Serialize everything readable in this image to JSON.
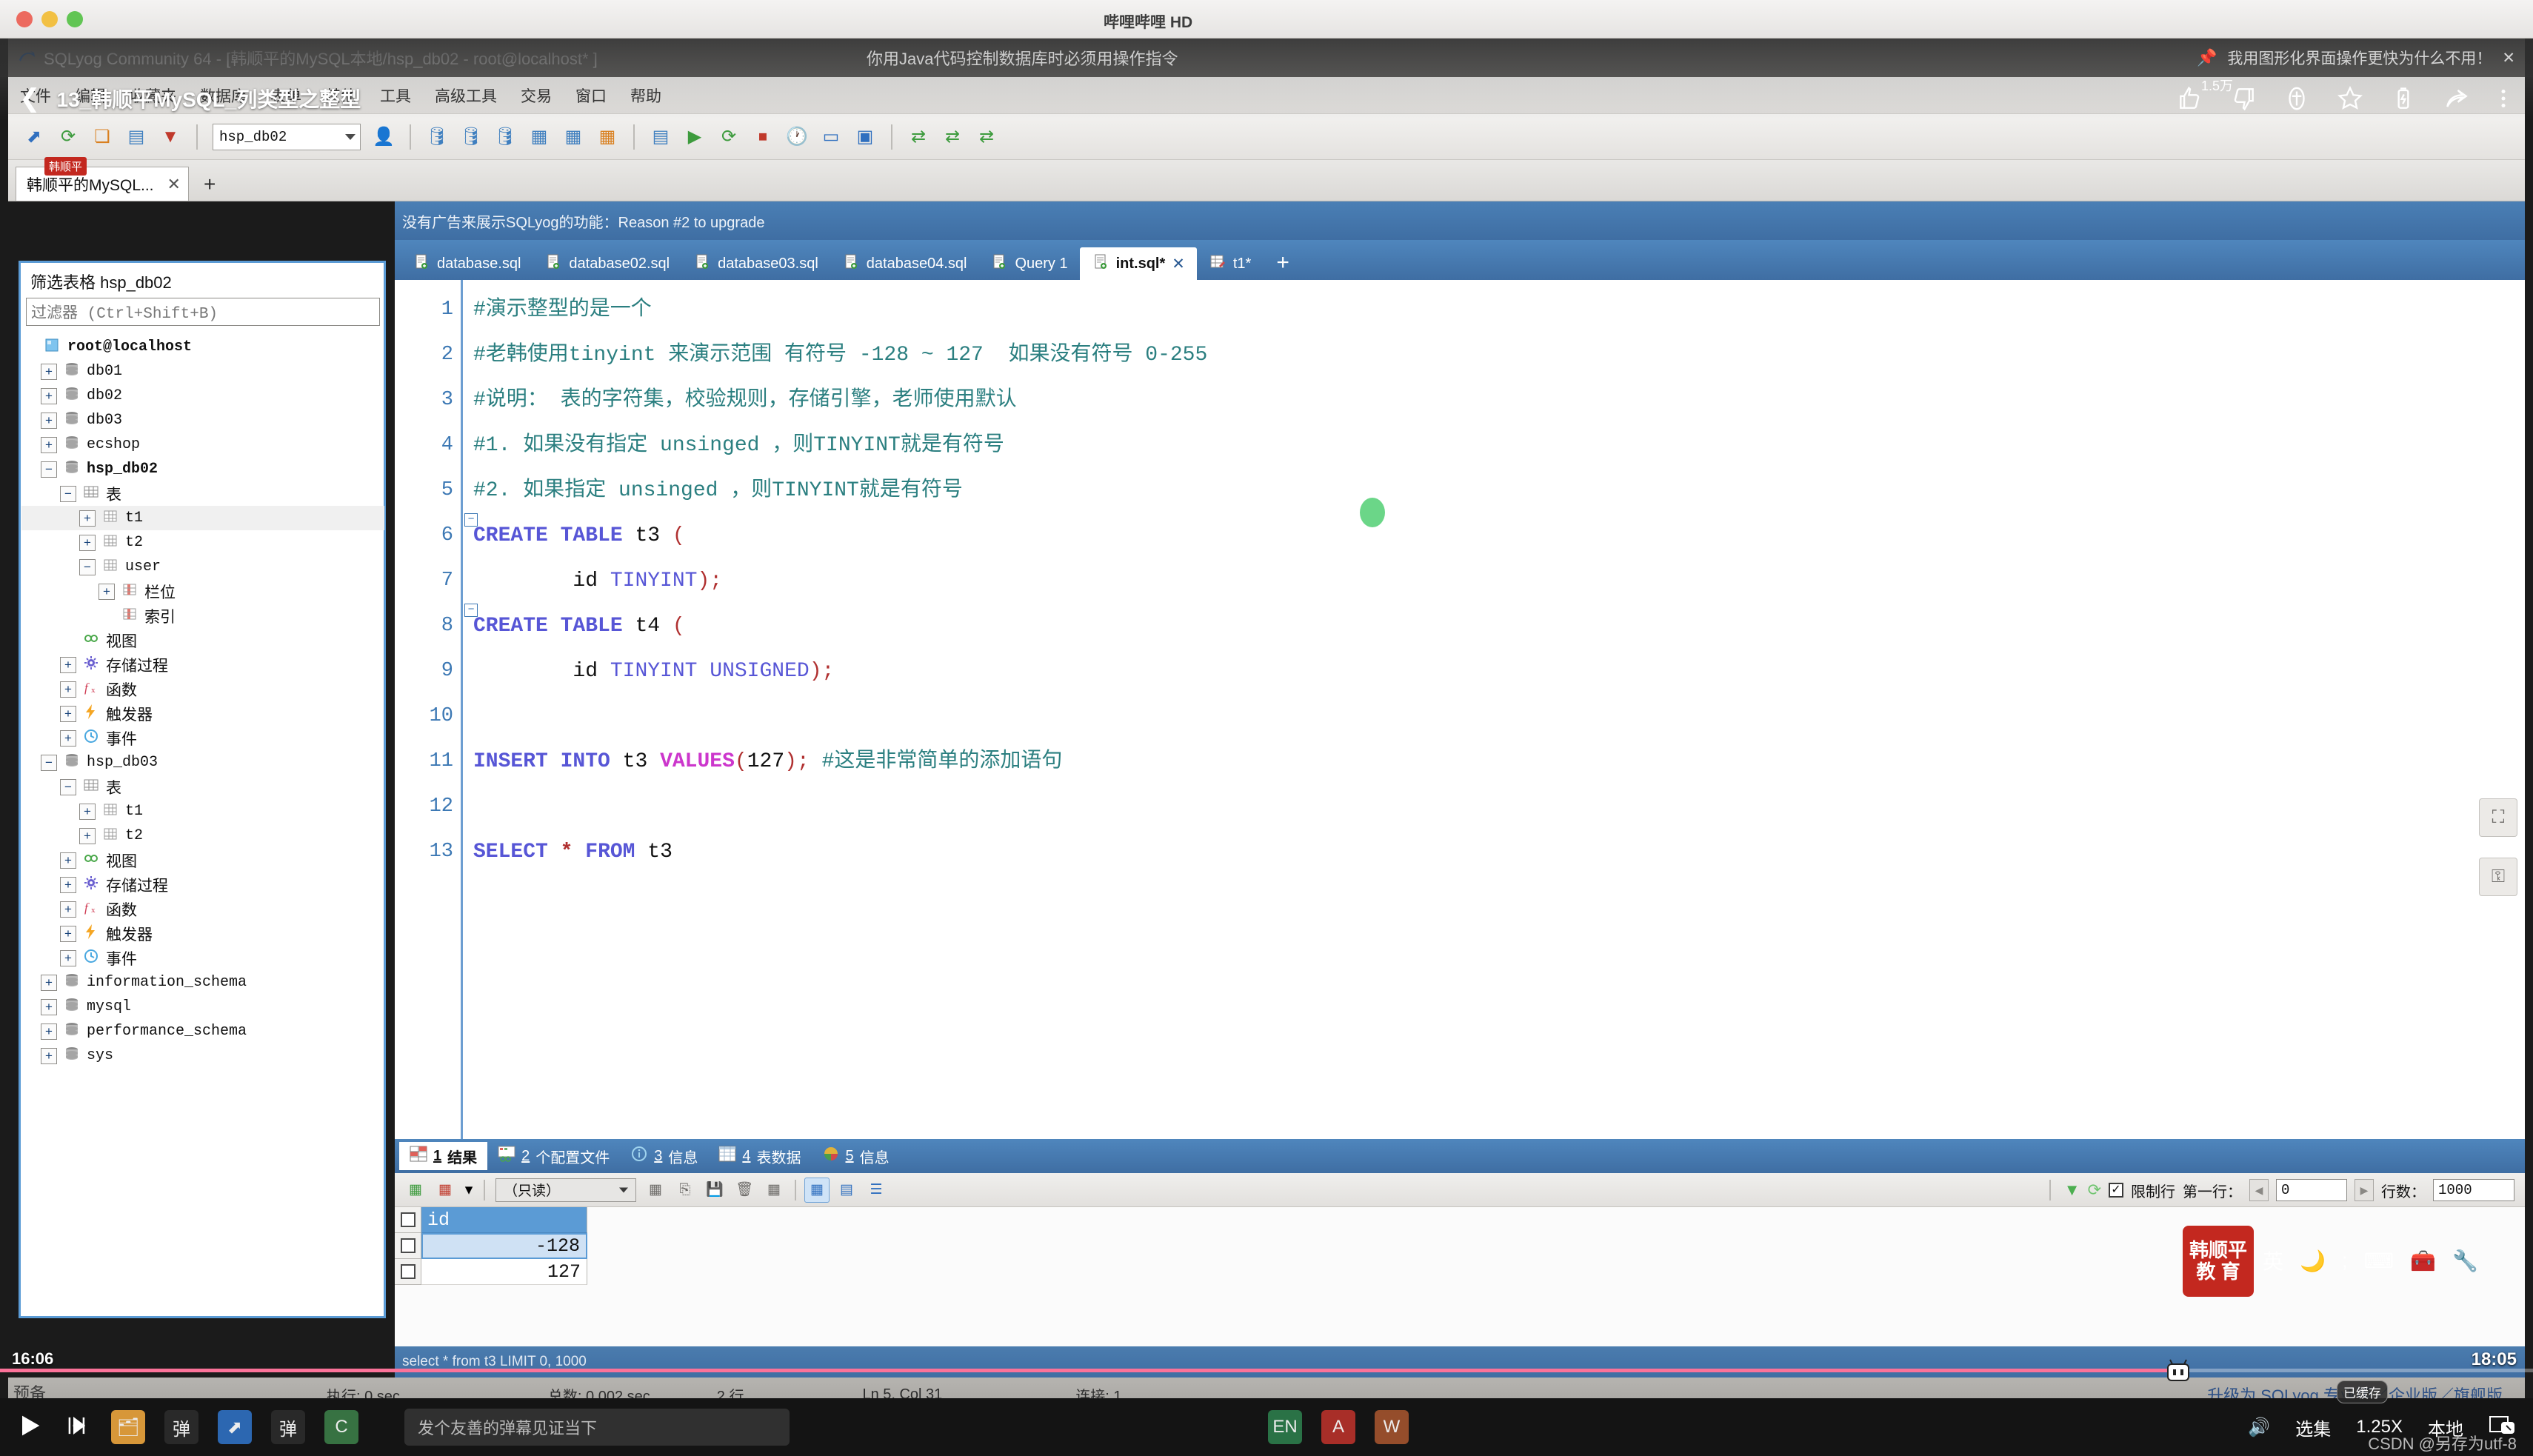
{
  "mac_window": {
    "buttons": [
      "close",
      "minimize",
      "maximize"
    ],
    "app_label": "哔哩哔哩 HD"
  },
  "player": {
    "top_overlay_danmaku": "你用Java代码控制数据库时必须用操作指令",
    "top_right_danmaku": "我用图形化界面操作更快为什么不用！",
    "close_label": "✕",
    "back_icon": "chevron-left-icon",
    "video_title": "13_韩顺平MySQL_列类型之整型",
    "actions": {
      "like_count": "1.5万",
      "like_icon": "thumbs-up-icon",
      "dislike_icon": "thumbs-down-icon",
      "coin_icon": "coin-icon",
      "favorite_icon": "star-icon",
      "charge_icon": "battery-charge-icon",
      "share_icon": "share-arrow-icon",
      "more_icon": "more-vertical-icon"
    },
    "progress": {
      "current_time": "16:06",
      "total_time": "18:05",
      "percent": 86,
      "accent_color": "#fb7299"
    },
    "controls": {
      "play_icon": "play-icon",
      "next_icon": "next-track-icon",
      "danmaku_placeholder": "发个友善的弹幕见证当下",
      "episodes_label": "选集",
      "speed_label": "1.25X",
      "quality_label": "本地",
      "cached_badge": "已缓存",
      "pip_icon": "picture-in-picture-icon",
      "volume_icon": "volume-icon"
    },
    "watermark": "CSDN @另存为utf-8",
    "prep_label": "预备",
    "ime": {
      "brand_line1": "韩顺平",
      "brand_line2": "教 育",
      "lang_label": "英",
      "moon_icon": "moon-icon",
      "keyboard_icon": "keyboard-icon",
      "toolbox_icon": "toolbox-icon",
      "wrench_icon": "wrench-icon"
    },
    "brand_tag": "韩顺平"
  },
  "sqlyog": {
    "title": "SQLyog Community 64 - [韩顺平的MySQL本地/hsp_db02 - root@localhost* ]",
    "logo_icon": "sqlyog-arrow-icon",
    "menu": [
      "文件",
      "编辑",
      "收藏夹",
      "数据库",
      "表单",
      "其他",
      "工具",
      "高级工具",
      "交易",
      "窗口",
      "帮助"
    ],
    "toolbar": {
      "db_selected": "hsp_db02",
      "icons": [
        "new-connection-icon",
        "refresh-objects-icon",
        "copy-database-icon",
        "sql-dump-icon",
        "import-icon",
        "user-manager-icon",
        "database-icon",
        "database-sync-icon",
        "database-compare-icon",
        "table-icon",
        "table-diagnostics-icon",
        "table-data-icon",
        "new-query-icon",
        "execute-query-icon",
        "execute-all-icon",
        "stop-query-icon",
        "query-history-icon",
        "schema-designer-icon",
        "query-builder-icon",
        "data-sync-icon",
        "data-sync-wizard-icon",
        "notification-services-icon"
      ]
    },
    "connection_tab": {
      "label": "韩顺平的MySQL...",
      "close_icon": "✕",
      "add_icon": "+"
    },
    "object_browser": {
      "title": "筛选表格 hsp_db02",
      "filter_placeholder": "过滤器 (Ctrl+Shift+B)",
      "tree": [
        {
          "indent": 0,
          "toggle": "none",
          "icon": "host-icon",
          "label": "root@localhost",
          "bold": true,
          "cjk": false
        },
        {
          "indent": 1,
          "toggle": "plus",
          "icon": "database-icon",
          "label": "db01",
          "bold": false,
          "cjk": false
        },
        {
          "indent": 1,
          "toggle": "plus",
          "icon": "database-icon",
          "label": "db02",
          "bold": false,
          "cjk": false
        },
        {
          "indent": 1,
          "toggle": "plus",
          "icon": "database-icon",
          "label": "db03",
          "bold": false,
          "cjk": false
        },
        {
          "indent": 1,
          "toggle": "plus",
          "icon": "database-icon",
          "label": "ecshop",
          "bold": false,
          "cjk": false
        },
        {
          "indent": 1,
          "toggle": "minus",
          "icon": "database-icon",
          "label": "hsp_db02",
          "bold": true,
          "cjk": false
        },
        {
          "indent": 2,
          "toggle": "minus",
          "icon": "tables-icon",
          "label": "表",
          "bold": false,
          "cjk": true
        },
        {
          "indent": 3,
          "toggle": "plus",
          "icon": "table-icon",
          "label": "t1",
          "bold": false,
          "cjk": false,
          "selected": true
        },
        {
          "indent": 3,
          "toggle": "plus",
          "icon": "table-icon",
          "label": "t2",
          "bold": false,
          "cjk": false
        },
        {
          "indent": 3,
          "toggle": "minus",
          "icon": "table-icon",
          "label": "user",
          "bold": false,
          "cjk": false
        },
        {
          "indent": 4,
          "toggle": "plus",
          "icon": "columns-icon",
          "label": "栏位",
          "bold": false,
          "cjk": true
        },
        {
          "indent": 4,
          "toggle": "none",
          "icon": "indexes-icon",
          "label": "索引",
          "bold": false,
          "cjk": true
        },
        {
          "indent": 2,
          "toggle": "none",
          "icon": "view-icon",
          "label": "视图",
          "bold": false,
          "cjk": true
        },
        {
          "indent": 2,
          "toggle": "plus",
          "icon": "procedure-icon",
          "label": "存储过程",
          "bold": false,
          "cjk": true
        },
        {
          "indent": 2,
          "toggle": "plus",
          "icon": "function-icon",
          "label": "函数",
          "bold": false,
          "cjk": true
        },
        {
          "indent": 2,
          "toggle": "plus",
          "icon": "trigger-icon",
          "label": "触发器",
          "bold": false,
          "cjk": true
        },
        {
          "indent": 2,
          "toggle": "plus",
          "icon": "event-icon",
          "label": "事件",
          "bold": false,
          "cjk": true
        },
        {
          "indent": 1,
          "toggle": "minus",
          "icon": "database-icon",
          "label": "hsp_db03",
          "bold": false,
          "cjk": false
        },
        {
          "indent": 2,
          "toggle": "minus",
          "icon": "tables-icon",
          "label": "表",
          "bold": false,
          "cjk": true
        },
        {
          "indent": 3,
          "toggle": "plus",
          "icon": "table-icon",
          "label": "t1",
          "bold": false,
          "cjk": false
        },
        {
          "indent": 3,
          "toggle": "plus",
          "icon": "table-icon",
          "label": "t2",
          "bold": false,
          "cjk": false
        },
        {
          "indent": 2,
          "toggle": "plus",
          "icon": "view-icon",
          "label": "视图",
          "bold": false,
          "cjk": true
        },
        {
          "indent": 2,
          "toggle": "plus",
          "icon": "procedure-icon",
          "label": "存储过程",
          "bold": false,
          "cjk": true
        },
        {
          "indent": 2,
          "toggle": "plus",
          "icon": "function-icon",
          "label": "函数",
          "bold": false,
          "cjk": true
        },
        {
          "indent": 2,
          "toggle": "plus",
          "icon": "trigger-icon",
          "label": "触发器",
          "bold": false,
          "cjk": true
        },
        {
          "indent": 2,
          "toggle": "plus",
          "icon": "event-icon",
          "label": "事件",
          "bold": false,
          "cjk": true
        },
        {
          "indent": 1,
          "toggle": "plus",
          "icon": "database-icon",
          "label": "information_schema",
          "bold": false,
          "cjk": false
        },
        {
          "indent": 1,
          "toggle": "plus",
          "icon": "database-icon",
          "label": "mysql",
          "bold": false,
          "cjk": false
        },
        {
          "indent": 1,
          "toggle": "plus",
          "icon": "database-icon",
          "label": "performance_schema",
          "bold": false,
          "cjk": false
        },
        {
          "indent": 1,
          "toggle": "plus",
          "icon": "database-icon",
          "label": "sys",
          "bold": false,
          "cjk": false
        }
      ]
    },
    "ad_bar": "没有广告来展示SQLyog的功能：Reason #2 to upgrade",
    "sql_tabs": [
      {
        "label": "database.sql",
        "icon": "sql-file-icon",
        "active": false
      },
      {
        "label": "database02.sql",
        "icon": "sql-file-icon",
        "active": false
      },
      {
        "label": "database03.sql",
        "icon": "sql-file-icon",
        "active": false
      },
      {
        "label": "database04.sql",
        "icon": "sql-file-icon",
        "active": false
      },
      {
        "label": "Query 1",
        "icon": "sql-file-icon",
        "active": false
      },
      {
        "label": "int.sql*",
        "icon": "sql-file-icon",
        "active": true,
        "close_icon": "✕"
      },
      {
        "label": "t1*",
        "icon": "table-edit-icon",
        "active": false
      }
    ],
    "sql_tab_add": "+",
    "editor": {
      "line_numbers": [
        1,
        2,
        3,
        4,
        5,
        6,
        7,
        8,
        9,
        10,
        11,
        12,
        13
      ],
      "lines": [
        "#演示整型的是一个",
        "#老韩使用tinyint 来演示范围 有符号 -128 ~ 127  如果没有符号 0-255",
        "#说明： 表的字符集，校验规则，存储引擎，老师使用默认",
        "#1. 如果没有指定 unsinged ，则TINYINT就是有符号",
        "#2. 如果指定 unsinged ，则TINYINT就是有符号",
        "CREATE TABLE t3 (",
        "        id TINYINT);",
        "CREATE TABLE t4 (",
        "        id TINYINT UNSIGNED);",
        "",
        "INSERT INTO t3 VALUES(127); #这是非常简单的添加语句",
        "",
        "SELECT * FROM t3"
      ]
    },
    "results": {
      "tabs": [
        {
          "num": "1",
          "label": "结果",
          "icon": "result-grid-icon",
          "active": true
        },
        {
          "num": "2",
          "label": "个配置文件",
          "icon": "profile-icon",
          "active": false
        },
        {
          "num": "3",
          "label": "信息",
          "icon": "info-icon",
          "active": false
        },
        {
          "num": "4",
          "label": "表数据",
          "icon": "table-data-icon",
          "active": false
        },
        {
          "num": "5",
          "label": "信息",
          "icon": "pie-info-icon",
          "active": false
        }
      ],
      "toolbar": {
        "mode_value": "（只读）",
        "icons": [
          "refresh-data-icon",
          "grid-options-icon",
          "search-grid-icon",
          "export-grid-icon",
          "save-changes-icon",
          "delete-row-icon",
          "cancel-changes-icon",
          "grid-view-icon",
          "form-view-icon",
          "text-view-icon"
        ],
        "filter_icon": "funnel-icon",
        "reload_icon": "reload-icon",
        "limit_checkbox_label": "限制行",
        "limit_checked": true,
        "first_row_label": "第一行：",
        "first_row_value": "0",
        "rows_label": "行数：",
        "rows_value": "1000"
      },
      "grid": {
        "columns": [
          "id"
        ],
        "rows": [
          [
            "-128"
          ],
          [
            "127"
          ]
        ],
        "selected_cell": {
          "row": 0,
          "col": 0
        }
      }
    },
    "query_echo": "select * from t3 LIMIT 0, 1000",
    "statusbar": {
      "exec_label": "执行: 0 sec",
      "total_label": "总数: 0.002 sec",
      "rows_label": "2 行",
      "caret_label": "Ln 5, Col 31",
      "conn_label": "连接: 1",
      "upgrade_label": "升级为 SQLyog 专业版／企业版／旗舰版"
    },
    "float_buttons": [
      "camera-icon",
      "unlock-icon"
    ]
  }
}
